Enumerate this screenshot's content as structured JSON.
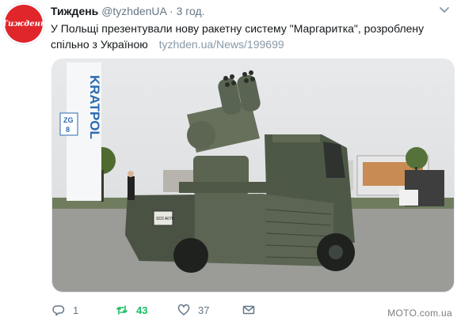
{
  "tweet": {
    "author_name": "Тиждень",
    "handle": "@tyzhdenUA",
    "separator": "·",
    "time": "3 год.",
    "text": "У Польщі презентували нову ракетну систему \"Маргаритка\", розроблену спільно з Україною",
    "link": "tyzhden.ua/News/199699",
    "avatar_text": "Тиждень",
    "avatar_color": "#e0262b"
  },
  "media": {
    "banner_text": "KRATPOL",
    "sign_text_1": "ZG",
    "sign_text_2": "8",
    "plate_text": "SD2 A076",
    "accent_truck_color": "#5c6553"
  },
  "actions": {
    "replies": "1",
    "retweets": "43",
    "likes": "37",
    "retweet_color": "#17bf63"
  },
  "watermark": "MOTO.com.ua"
}
